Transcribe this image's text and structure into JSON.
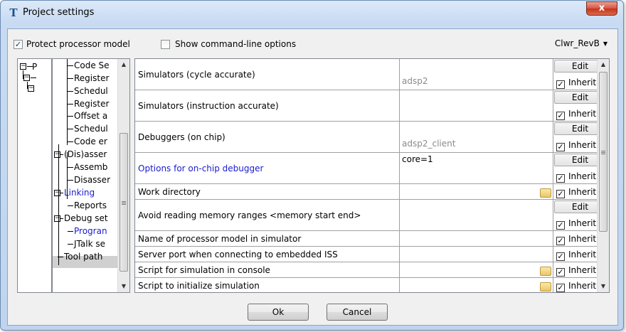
{
  "window": {
    "title": "Project settings",
    "close_symbol": "x"
  },
  "options": {
    "protect_label": "Protect processor model",
    "protect_checked": true,
    "cmdline_label": "Show command-line options",
    "cmdline_checked": false,
    "profile": "Clwr_RevB",
    "profile_arrow": "▼"
  },
  "tree_left": {
    "root_label": "P"
  },
  "tree": {
    "items": [
      {
        "label": "Code Se",
        "link": false
      },
      {
        "label": "Register",
        "link": false
      },
      {
        "label": "Schedul",
        "link": false
      },
      {
        "label": "Register",
        "link": false
      },
      {
        "label": "Offset a",
        "link": false
      },
      {
        "label": "Schedul",
        "link": false
      },
      {
        "label": "Code er",
        "link": false
      },
      {
        "label": "(Dis)asser",
        "link": false
      },
      {
        "label": "Assemb",
        "link": false
      },
      {
        "label": "Disasser",
        "link": false
      },
      {
        "label": "Linking",
        "link": true
      },
      {
        "label": "Reports",
        "link": false
      },
      {
        "label": "Debug set",
        "link": false
      },
      {
        "label": "Progran",
        "link": true
      },
      {
        "label": "JTalk se",
        "link": false
      },
      {
        "label": "Tool path",
        "link": false
      }
    ]
  },
  "grid": {
    "edit_label": "Edit",
    "inherit_label": "Inherit",
    "rows": [
      {
        "name": "Simulators (cycle accurate)",
        "placeholder": "adsp2",
        "value": "",
        "edit": true,
        "inherit": true,
        "folder": false,
        "link": false
      },
      {
        "name": "Simulators (instruction accurate)",
        "placeholder": "",
        "value": "",
        "edit": true,
        "inherit": true,
        "folder": false,
        "link": false
      },
      {
        "name": "Debuggers (on chip)",
        "placeholder": "adsp2_client",
        "value": "",
        "edit": true,
        "inherit": true,
        "folder": false,
        "link": false
      },
      {
        "name": "Options for on-chip debugger",
        "placeholder": "",
        "value": "core=1",
        "edit": true,
        "inherit": true,
        "folder": false,
        "link": true
      },
      {
        "name": "Work directory",
        "placeholder": "",
        "value": "",
        "edit": false,
        "inherit": true,
        "folder": true,
        "link": false
      },
      {
        "name": "Avoid reading memory ranges  <memory start end>",
        "placeholder": "",
        "value": "",
        "edit": true,
        "inherit": true,
        "folder": false,
        "link": false
      },
      {
        "name": "Name of processor model in simulator",
        "placeholder": "",
        "value": "",
        "edit": false,
        "inherit": true,
        "folder": false,
        "link": false
      },
      {
        "name": "Server port when connecting to embedded ISS",
        "placeholder": "",
        "value": "",
        "edit": false,
        "inherit": true,
        "folder": false,
        "link": false
      },
      {
        "name": "Script for simulation in console",
        "placeholder": "",
        "value": "",
        "edit": false,
        "inherit": true,
        "folder": true,
        "link": false
      },
      {
        "name": "Script to initialize simulation",
        "placeholder": "",
        "value": "",
        "edit": false,
        "inherit": true,
        "folder": true,
        "link": false
      }
    ]
  },
  "buttons": {
    "ok": "Ok",
    "cancel": "Cancel"
  },
  "icons": {
    "app": "T-app-icon",
    "check": "✓"
  }
}
